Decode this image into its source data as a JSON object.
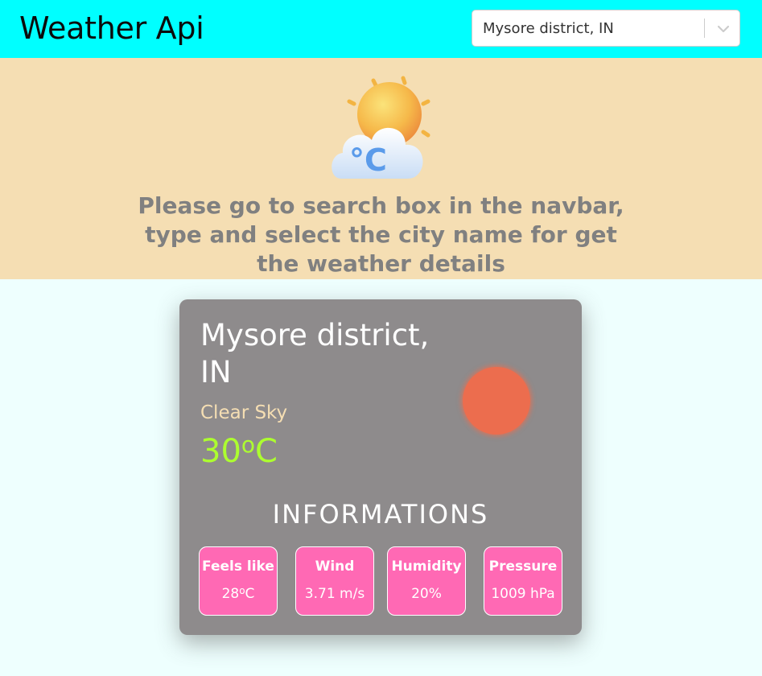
{
  "navbar": {
    "brand": "Weather Api",
    "search": {
      "selected_value": "Mysore district, IN"
    }
  },
  "hero": {
    "icon": "sun-cloud-celsius-icon",
    "message": "Please go to search box in the navbar, type and select the city name for get the weather details"
  },
  "card": {
    "city_line1": "Mysore district,",
    "city_line2": "IN",
    "description": "Clear Sky",
    "temperature_value": "30",
    "temperature_unit": "C",
    "info_heading": "INFORMATIONS",
    "tiles": [
      {
        "label": "Feels like",
        "value": "28",
        "unit": "C"
      },
      {
        "label": "Wind",
        "value": "3.71 m/s"
      },
      {
        "label": "Humidity",
        "value": "20%"
      },
      {
        "label": "Pressure",
        "value": "1009 hPa"
      }
    ]
  },
  "colors": {
    "navbar": "#00ffff",
    "hero": "#f5deb3",
    "card": "#8e8b8c",
    "tile": "#ff69b4",
    "temperature": "#adff2f",
    "sun": "#ec6d4e"
  }
}
